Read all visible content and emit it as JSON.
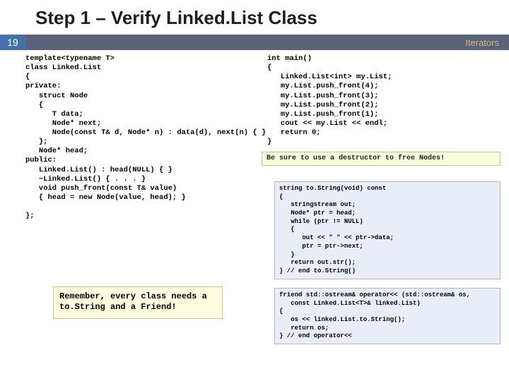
{
  "title": "Step 1 – Verify Linked.List Class",
  "page_number": "19",
  "bar_label": "Iterators",
  "code_left": "template<typename T>\nclass Linked.List\n{\nprivate:\n   struct Node\n   {\n      T data;\n      Node* next;\n      Node(const T& d, Node* n) : data(d), next(n) { }\n   };\n   Node* head;\npublic:\n   Linked.List() : head(NULL) { }\n   ~Linked.List() { . . . }\n   void push_front(const T& value)\n   { head = new Node(value, head); }\n\n};",
  "code_right_top": "int main()\n{\n   Linked.List<int> my.List;\n   my.List.push_front(4);\n   my.List.push_front(3);\n   my.List.push_front(2);\n   my.List.push_front(1);\n   cout << my.List << endl;\n   return 0;\n}",
  "destructor_note": "Be sure to use a destructor to free Nodes!",
  "tostring_code": "string to.String(void) const\n{\n   stringstream out;\n   Node* ptr = head;\n   while (ptr != NULL)\n   {\n      out << \" \" << ptr->data;\n      ptr = ptr->next;\n   }\n   return out.str();\n} // end to.String()",
  "operator_code": "friend std::ostream& operator<< (std::ostream& os,\n   const Linked.List<T>& linked.List)\n{\n   os << linked.List.to.String();\n   return os;\n} // end operator<<",
  "remember_note": "Remember, every class needs a to.String and a Friend!"
}
